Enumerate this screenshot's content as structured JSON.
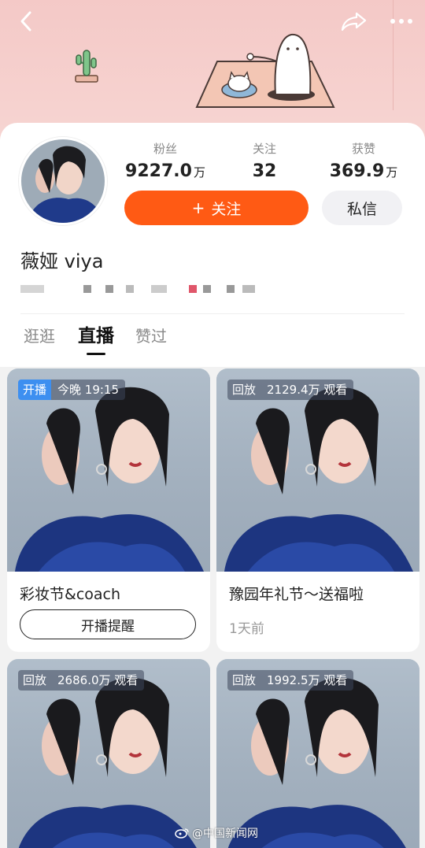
{
  "header": {
    "back_icon": "chevron-left-icon",
    "share_icon": "share-arrow-icon",
    "more_icon": "more-dots-icon"
  },
  "profile": {
    "stats": {
      "fans_label": "粉丝",
      "fans_value": "9227.0",
      "fans_unit": "万",
      "follow_label": "关注",
      "follow_value": "32",
      "likes_label": "获赞",
      "likes_value": "369.9",
      "likes_unit": "万"
    },
    "follow_button": "+ 关注",
    "follow_plus": "+",
    "follow_text": "关注",
    "message_button": "私信",
    "username": "薇娅 viya"
  },
  "tabs": [
    {
      "label": "逛逛",
      "active": false
    },
    {
      "label": "直播",
      "active": true
    },
    {
      "label": "赞过",
      "active": false
    }
  ],
  "cards": [
    {
      "tag": "开播",
      "info": "今晚 19:15",
      "title": "彩妆节&coach",
      "action": "开播提醒"
    },
    {
      "tag": "回放",
      "info": "2129.4万 观看",
      "title": "豫园年礼节～送福啦",
      "time": "1天前"
    },
    {
      "tag": "回放",
      "info": "2686.0万 观看"
    },
    {
      "tag": "回放",
      "info": "1992.5万 观看"
    }
  ],
  "watermark": "@中国新闻网",
  "colors": {
    "accent": "#ff5a14",
    "header_bg": "#f4c9c7",
    "live_tag": "#3d8ff0"
  }
}
